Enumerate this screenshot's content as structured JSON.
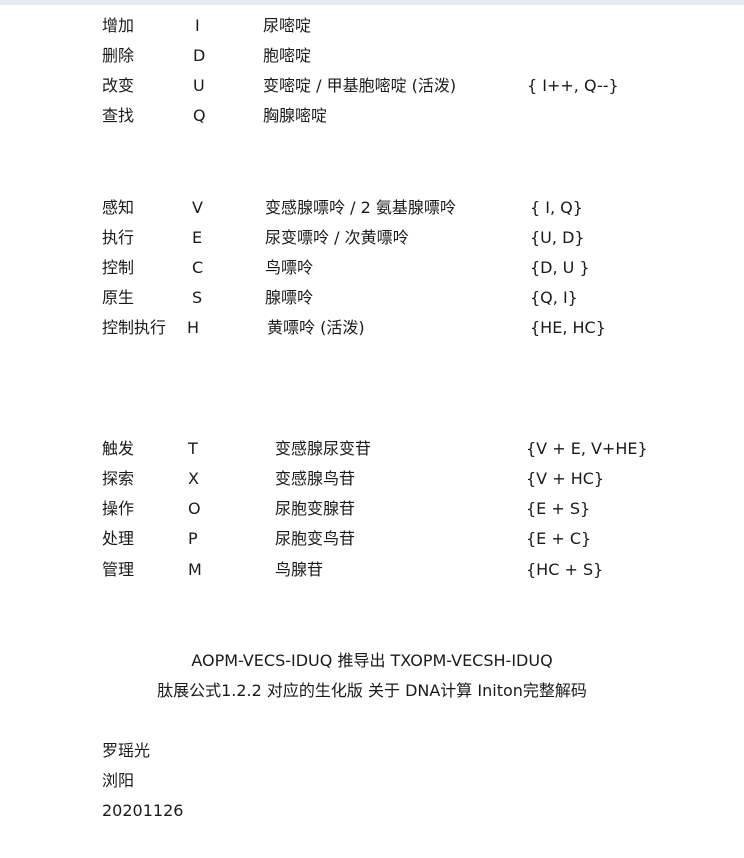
{
  "section1": [
    {
      "name": "增加",
      "code": "I",
      "base": "尿嘧啶",
      "rule": ""
    },
    {
      "name": "删除",
      "code": "D",
      "base": "胞嘧啶",
      "rule": ""
    },
    {
      "name": "改变",
      "code": "U",
      "base": "变嘧啶 / 甲基胞嘧啶  (活泼)",
      "rule": "{ I++,  Q--}"
    },
    {
      "name": "查找",
      "code": "Q",
      "base": "胸腺嘧啶",
      "rule": ""
    }
  ],
  "section2": [
    {
      "name": "感知",
      "code": "V",
      "base": "变感腺嘌呤  /  2 氨基腺嘌呤",
      "rule": "{ I,  Q}"
    },
    {
      "name": "执行",
      "code": "E",
      "base": "尿变嘌呤  /  次黄嘌呤",
      "rule": "{U, D}"
    },
    {
      "name": "控制",
      "code": "C",
      "base": "鸟嘌呤",
      "rule": "{D, U }"
    },
    {
      "name": "原生",
      "code": "S",
      "base": "腺嘌呤",
      "rule": "{Q,  I}"
    },
    {
      "name": "控制执行",
      "code": "H",
      "base": "黄嘌呤     (活泼)",
      "rule": "{HE, HC}"
    }
  ],
  "section3": [
    {
      "name": "触发",
      "code": "T",
      "base": "变感腺尿变苷",
      "rule": "{V + E,   V+HE}"
    },
    {
      "name": "探索",
      "code": "X",
      "base": "变感腺鸟苷",
      "rule": "{V + HC}"
    },
    {
      "name": "操作",
      "code": "O",
      "base": "尿胞变腺苷",
      "rule": "{E + S}"
    },
    {
      "name": "处理",
      "code": "P",
      "base": "尿胞变鸟苷",
      "rule": "{E + C}"
    },
    {
      "name": "管理",
      "code": "M",
      "base": "鸟腺苷",
      "rule": "{HC + S}"
    }
  ],
  "summary": {
    "line1": "AOPM-VECS-IDUQ    推导出   TXOPM-VECSH-IDUQ",
    "line2": "肽展公式1.2.2 对应的生化版 关于 DNA计算 Initon完整解码"
  },
  "signature": {
    "author": "罗瑶光",
    "place": "浏阳",
    "date": "20201126"
  }
}
